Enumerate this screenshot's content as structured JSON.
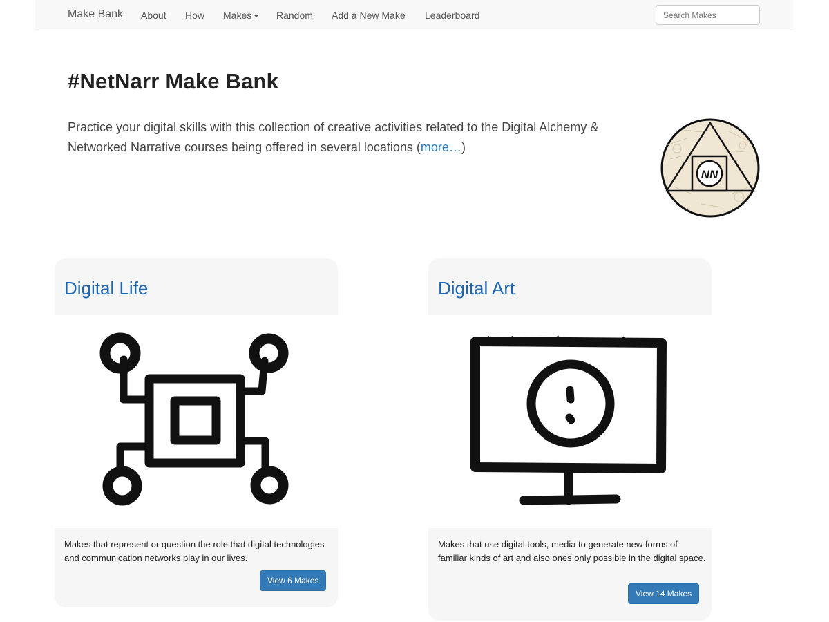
{
  "navbar": {
    "brand": "Make Bank",
    "items": [
      {
        "label": "About"
      },
      {
        "label": "How"
      },
      {
        "label": "Makes"
      },
      {
        "label": "Random"
      },
      {
        "label": "Add a New Make"
      },
      {
        "label": "Leaderboard"
      }
    ],
    "search_placeholder": "Search Makes"
  },
  "hero": {
    "title": "#NetNarr Make Bank",
    "text_before": "Practice your digital skills with this collection of creative activities related to the Digital Alchemy & Networked Narrative courses being offered in several locations (",
    "more_link": "more…",
    "text_after": ")",
    "logo_text": "NN"
  },
  "cards": [
    {
      "title": "Digital Life",
      "description": "Makes that represent or question the role that digital technologies and communication networks play in our lives.",
      "button": "View 6 Makes",
      "icon": "circuit-chip-icon"
    },
    {
      "title": "Digital Art",
      "description": "Makes that use digital tools, media to generate new forms of familiar kinds of art and also ones only possible in the digital space.",
      "button": "View 14 Makes",
      "icon": "monitor-face-icon"
    }
  ],
  "colors": {
    "link": "#337ab7",
    "card_title": "#1f66b0",
    "button": "#337ab7",
    "navbar_bg": "#f8f8f8",
    "card_bg": "#f6f6f6"
  }
}
